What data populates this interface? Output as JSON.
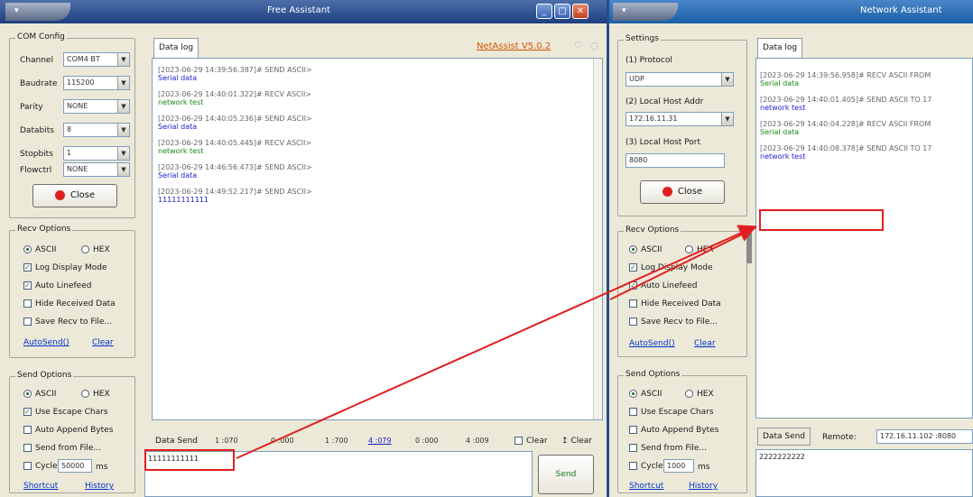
{
  "left": {
    "title": "Free Assistant",
    "com_config": {
      "group_title": "COM Config",
      "fields": [
        {
          "label": "Channel",
          "value": "COM4 BT"
        },
        {
          "label": "Baudrate",
          "value": "115200"
        },
        {
          "label": "Parity",
          "value": "NONE"
        },
        {
          "label": "Databits",
          "value": "8"
        },
        {
          "label": "Stopbits",
          "value": "1"
        },
        {
          "label": "Flowctrl",
          "value": "NONE"
        }
      ],
      "close_label": "Close"
    },
    "recv_options": {
      "group_title": "Recv Options",
      "ascii": "ASCII",
      "hex": "HEX",
      "checks": [
        "Log Display Mode",
        "Auto Linefeed",
        "Hide Received Data",
        "Save Recv to File..."
      ],
      "autosave": "AutoSend()",
      "clear": "Clear"
    },
    "send_options": {
      "group_title": "Send Options",
      "ascii": "ASCII",
      "hex": "HEX",
      "checks": [
        "Use Escape Chars",
        "Auto Append Bytes",
        "Send from File...",
        "Cycle"
      ],
      "cycle_value": "50000",
      "cycle_unit": "ms",
      "shortcut": "Shortcut",
      "history": "History"
    },
    "datalog_tab": "Data log",
    "version": "NetAssist V5.0.2",
    "log": [
      {
        "ts": "[2023-06-29 14:39:56.387]# SEND ASCII>",
        "text": "Serial data",
        "color": "#1a1acc"
      },
      {
        "ts": "[2023-06-29 14:40:01.322]# RECV ASCII>",
        "text": "network test",
        "color": "#1a8a1a"
      },
      {
        "ts": "[2023-06-29 14:40:05.236]# SEND ASCII>",
        "text": "Serial data",
        "color": "#1a1acc"
      },
      {
        "ts": "[2023-06-29 14:40:05.445]# RECV ASCII>",
        "text": "network test",
        "color": "#1a8a1a"
      },
      {
        "ts": "[2023-06-29 14:46:56.473]# SEND ASCII>",
        "text": "Serial data",
        "color": "#1a1acc"
      },
      {
        "ts": "[2023-06-29 14:49:52.217]# SEND ASCII>",
        "text": "11111111111",
        "color": "#1a1acc"
      }
    ],
    "data_send_label": "Data Send",
    "counters": [
      "1 :070",
      "0 :000",
      "1 :700",
      "4 :079",
      "0 :000",
      "4 :009"
    ],
    "clear1": "Clear",
    "clear2": "Clear",
    "send_input": "11111111111",
    "send_button": "Send"
  },
  "right": {
    "title": "Network Assistant",
    "settings": {
      "group_title": "Settings",
      "protocol_label": "(1) Protocol",
      "protocol_value": "UDP",
      "local_addr_label": "(2) Local Host Addr",
      "local_addr_value": "172.16.11.31",
      "local_port_label": "(3) Local Host Port",
      "local_port_value": "8080",
      "close_label": "Close"
    },
    "recv_options": {
      "group_title": "Recv Options",
      "ascii": "ASCII",
      "hex": "HEX",
      "checks": [
        "Log Display Mode",
        "Auto Linefeed",
        "Hide Received Data",
        "Save Recv to File..."
      ],
      "autosave": "AutoSend()",
      "clear": "Clear"
    },
    "send_options": {
      "group_title": "Send Options",
      "ascii": "ASCII",
      "hex": "HEX",
      "checks": [
        "Use Escape Chars",
        "Auto Append Bytes",
        "Send from File...",
        "Cycle"
      ],
      "cycle_value": "1000",
      "cycle_unit": "ms",
      "shortcut": "Shortcut",
      "history": "History"
    },
    "datalog_tab": "Data log",
    "log": [
      {
        "ts": "[2023-06-29 14:39:56.958]# RECV ASCII FROM",
        "text": "Serial data",
        "color": "#1a8a1a"
      },
      {
        "ts": "[2023-06-29 14:40:01.405]# SEND ASCII TO 17",
        "text": "network test",
        "color": "#1a1acc"
      },
      {
        "ts": "[2023-06-29 14:40:04.228]# RECV ASCII FROM",
        "text": "Serial data",
        "color": "#1a8a1a"
      },
      {
        "ts": "[2023-06-29 14:40:08.378]# SEND ASCII TO 17",
        "text": "network test",
        "color": "#1a1acc"
      }
    ],
    "data_send_label": "Data Send",
    "remote_label": "Remote:",
    "remote_value": "172.16.11.102 :8080",
    "send_input": "2222222222"
  }
}
